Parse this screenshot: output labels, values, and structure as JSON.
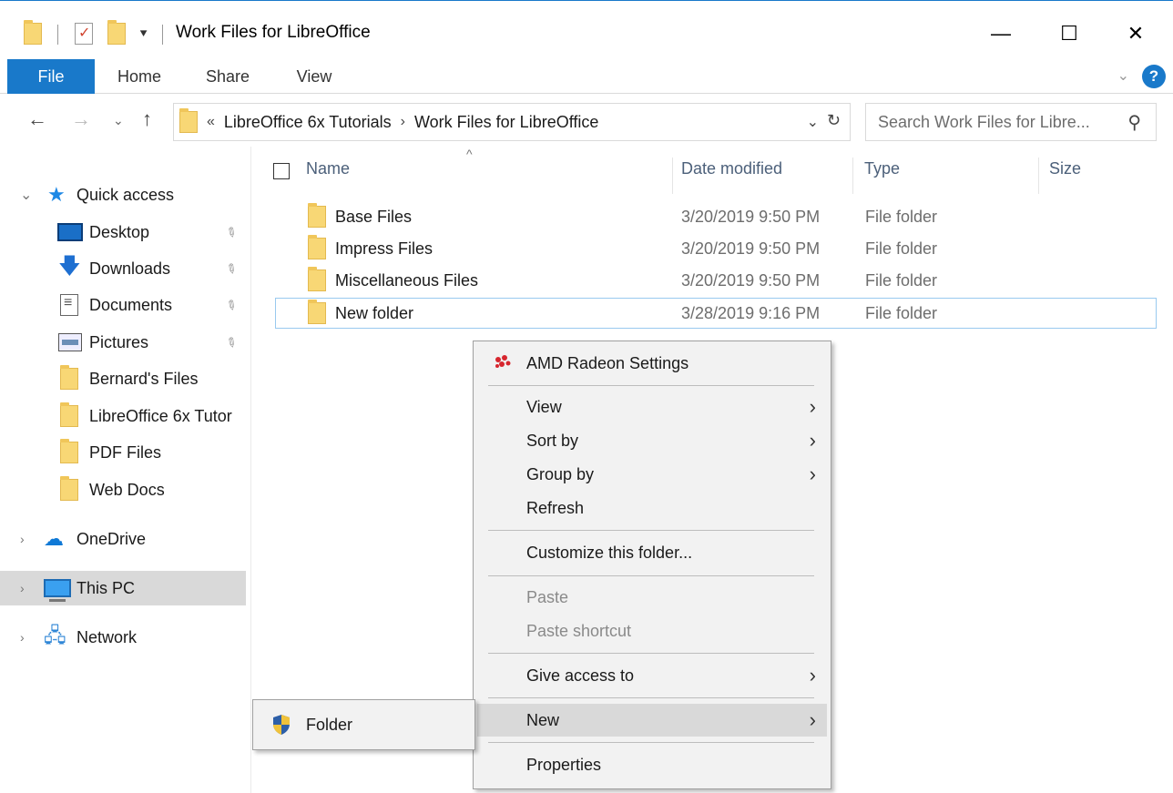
{
  "window": {
    "title": "Work Files for LibreOffice",
    "controls": {
      "minimize": "—",
      "maximize": "☐",
      "close": "✕"
    },
    "quick_access_arrow": "⯆"
  },
  "ribbon": {
    "tabs": [
      "File",
      "Home",
      "Share",
      "View"
    ],
    "help": "?",
    "collapse": "⌄"
  },
  "address": {
    "back": "←",
    "forward": "→",
    "recent": "⌄",
    "up": "↑",
    "overflow": "«",
    "crumbs": [
      "LibreOffice 6x Tutorials",
      "Work Files for LibreOffice"
    ],
    "separator": "›",
    "dropdown": "⌄",
    "refresh": "↻",
    "search_placeholder": "Search Work Files for Libre...",
    "search_icon": "⚲"
  },
  "nav": {
    "quick_access": "Quick access",
    "pinned": [
      {
        "label": "Desktop",
        "icon": "desktop-icon"
      },
      {
        "label": "Downloads",
        "icon": "download-arrow-icon"
      },
      {
        "label": "Documents",
        "icon": "documents-icon"
      },
      {
        "label": "Pictures",
        "icon": "pictures-icon"
      }
    ],
    "folders": [
      "Bernard's Files",
      "LibreOffice 6x Tutor",
      "PDF Files",
      "Web Docs"
    ],
    "onedrive": "OneDrive",
    "this_pc": "This PC",
    "network": "Network",
    "pin_glyph": "📌",
    "collapsed_chevron": "›",
    "expanded_chevron": "⌄"
  },
  "list": {
    "columns": {
      "name": "Name",
      "date": "Date modified",
      "type": "Type",
      "size": "Size"
    },
    "sort_caret": "^",
    "rows": [
      {
        "name": "Base Files",
        "date": "3/20/2019 9:50 PM",
        "type": "File folder"
      },
      {
        "name": "Impress Files",
        "date": "3/20/2019 9:50 PM",
        "type": "File folder"
      },
      {
        "name": "Miscellaneous Files",
        "date": "3/20/2019 9:50 PM",
        "type": "File folder"
      },
      {
        "name": "New folder",
        "date": "3/28/2019 9:16 PM",
        "type": "File folder"
      }
    ]
  },
  "context_menu": {
    "amd": "AMD Radeon Settings",
    "view": "View",
    "sort_by": "Sort by",
    "group_by": "Group by",
    "refresh": "Refresh",
    "customize": "Customize this folder...",
    "paste": "Paste",
    "paste_shortcut": "Paste shortcut",
    "give_access": "Give access to",
    "new": "New",
    "properties": "Properties",
    "submenu_arrow": "›"
  },
  "new_submenu": {
    "folder": "Folder"
  },
  "colors": {
    "accent": "#1979ca",
    "folder": "#f8d775",
    "menu_bg": "#f2f2f2",
    "hot": "#d9d9d9",
    "header_text": "#4c607a"
  }
}
